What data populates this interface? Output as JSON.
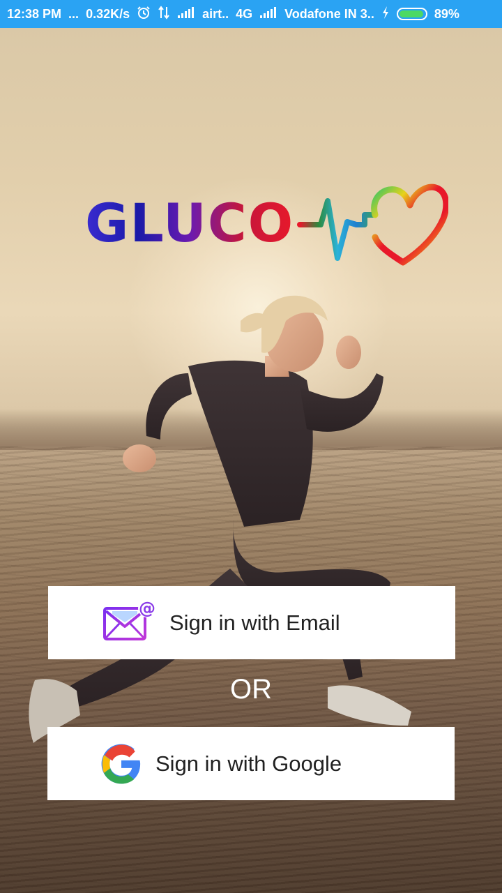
{
  "status_bar": {
    "time": "12:38 PM",
    "dots": "...",
    "speed": "0.32K/s",
    "carrier1": "airt..",
    "network1": "4G",
    "carrier2": "Vodafone IN 3..",
    "battery": "89%",
    "icons": [
      "alarm-icon",
      "data-transfer-icon",
      "signal-icon",
      "charging-icon",
      "battery-icon"
    ]
  },
  "logo": {
    "text": "GLUCO",
    "icons": [
      "heartbeat-icon",
      "heart-icon"
    ]
  },
  "email_button": {
    "label": "Sign in with Email",
    "icon": "email-at-icon"
  },
  "separator": {
    "text": "OR"
  },
  "google_button": {
    "label": "Sign in with Google",
    "icon": "google-icon"
  },
  "colors": {
    "status_bar": "#2aa3f3",
    "button_bg": "#ffffff",
    "button_text": "#212121"
  }
}
